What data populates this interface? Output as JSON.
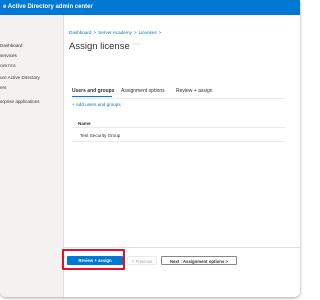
{
  "topbar": {
    "title": "e Active Directory admin center"
  },
  "sidebar": {
    "items": [
      {
        "label": "Dashboard"
      },
      {
        "label": "services"
      },
      {
        "label": "ORITES",
        "section": true
      },
      {
        "label": "ure Active Directory"
      },
      {
        "label": "ers"
      },
      {
        "label": "erprise applications"
      }
    ]
  },
  "breadcrumb": {
    "items": [
      "Dashboard",
      "Server Academy",
      "Licenses"
    ]
  },
  "page": {
    "title": "Assign license",
    "more": "···"
  },
  "tabs": [
    {
      "label": "Users and groups",
      "active": true
    },
    {
      "label": "Assignment options",
      "active": false
    },
    {
      "label": "Review + assign",
      "active": false
    }
  ],
  "actions": {
    "add_link": "+ Add users and groups"
  },
  "table": {
    "header": "Name",
    "rows": [
      {
        "name": "Test Security Group"
      }
    ]
  },
  "footer": {
    "primary": "Review + assign",
    "previous": "< Previous",
    "next": "Next : Assignment options >"
  },
  "colors": {
    "accent": "#0078d4",
    "highlight": "#e81123"
  }
}
